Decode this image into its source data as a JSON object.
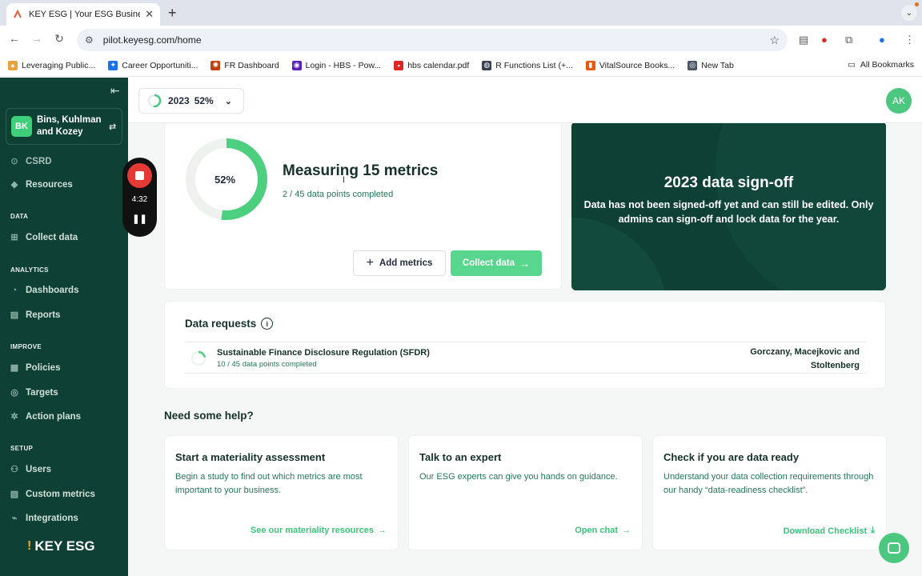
{
  "browser": {
    "tab_title": "KEY ESG | Your ESG Business",
    "url": "pilot.keyesg.com/home",
    "bookmarks": [
      {
        "label": "Leveraging Public...",
        "color": "#e8a33d"
      },
      {
        "label": "Career Opportuniti...",
        "color": "#1a73e8"
      },
      {
        "label": "FR Dashboard",
        "color": "#c2410c"
      },
      {
        "label": "Login - HBS - Pow...",
        "color": "#5b21b6"
      },
      {
        "label": "hbs calendar.pdf",
        "color": "#dc2626"
      },
      {
        "label": "R Functions List (+...",
        "color": "#374151"
      },
      {
        "label": "VitalSource Books...",
        "color": "#ea580c"
      },
      {
        "label": "New Tab",
        "color": "#4b5563"
      }
    ],
    "all_bookmarks": "All Bookmarks"
  },
  "sidebar": {
    "org_initials": "BK",
    "org_name": "Bins, Kuhlman and Kozey",
    "items": {
      "csrd": "CSRD",
      "resources": "Resources",
      "collect": "Collect data",
      "dashboards": "Dashboards",
      "reports": "Reports",
      "policies": "Policies",
      "targets": "Targets",
      "action_plans": "Action plans",
      "users": "Users",
      "custom_metrics": "Custom metrics",
      "integrations": "Integrations"
    },
    "sections": {
      "data": "DATA",
      "analytics": "ANALYTICS",
      "improve": "IMPROVE",
      "setup": "SETUP"
    },
    "logo": "KEY ESG"
  },
  "recorder": {
    "time": "4:32"
  },
  "header": {
    "year": "2023",
    "year_pct": "52%",
    "year_progress": 0.52,
    "user_initials": "AK"
  },
  "metrics": {
    "pct_label": "52%",
    "progress": 0.52,
    "title": "Measuring 15 metrics",
    "subtitle": "2 / 45 data points completed",
    "add_label": "Add metrics",
    "collect_label": "Collect data"
  },
  "signoff": {
    "title": "2023 data sign-off",
    "body": "Data has not been signed-off yet and can still be edited. Only admins can sign-off and lock data for the year."
  },
  "requests": {
    "title": "Data requests",
    "row": {
      "name": "Sustainable Finance Disclosure Regulation (SFDR)",
      "progress_text": "10 / 45 data points completed",
      "progress": 0.22,
      "org": "Gorczany, Macejkovic and Stoltenberg"
    }
  },
  "help": {
    "title": "Need some help?",
    "cards": [
      {
        "title": "Start a materiality assessment",
        "body": "Begin a study to find out which metrics are most important to your business.",
        "link": "See our materiality resources",
        "arrow": "→"
      },
      {
        "title": "Talk to an expert",
        "body": "Our ESG experts can give you hands on guidance.",
        "link": "Open chat",
        "arrow": "→"
      },
      {
        "title": "Check if you are data ready",
        "body": "Understand your data collection requirements through our handy “data-readiness checklist”.",
        "link": "Download Checklist",
        "arrow": "⤓"
      }
    ]
  },
  "colors": {
    "brand_green": "#0f4034",
    "accent": "#58d68d"
  }
}
